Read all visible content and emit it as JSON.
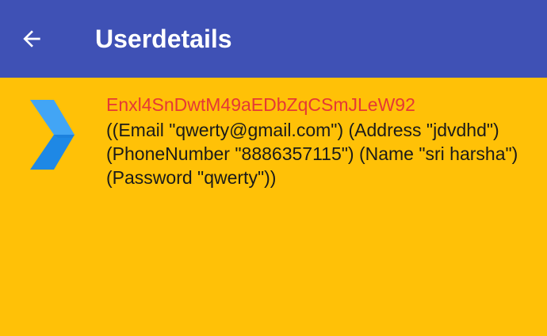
{
  "app_bar": {
    "title": "Userdetails",
    "back_icon": "arrow-back-icon",
    "background": "#3F51B5",
    "title_color": "#FFFFFF"
  },
  "content": {
    "background": "#FFC107",
    "items": [
      {
        "icon": "chevron-right-icon",
        "id": "Enxl4SnDwtM49aEDbZqCSmJLeW92",
        "details": "((Email \"qwerty@gmail.com\") (Address \"jdvdhd\") (PhoneNumber \"8886357115\") (Name \"sri harsha\") (Password \"qwerty\"))"
      }
    ]
  },
  "colors": {
    "id_text": "#E53935",
    "details_text": "#1A1A1A",
    "icon_light": "#42A5F5",
    "icon_dark": "#1E88E5"
  }
}
